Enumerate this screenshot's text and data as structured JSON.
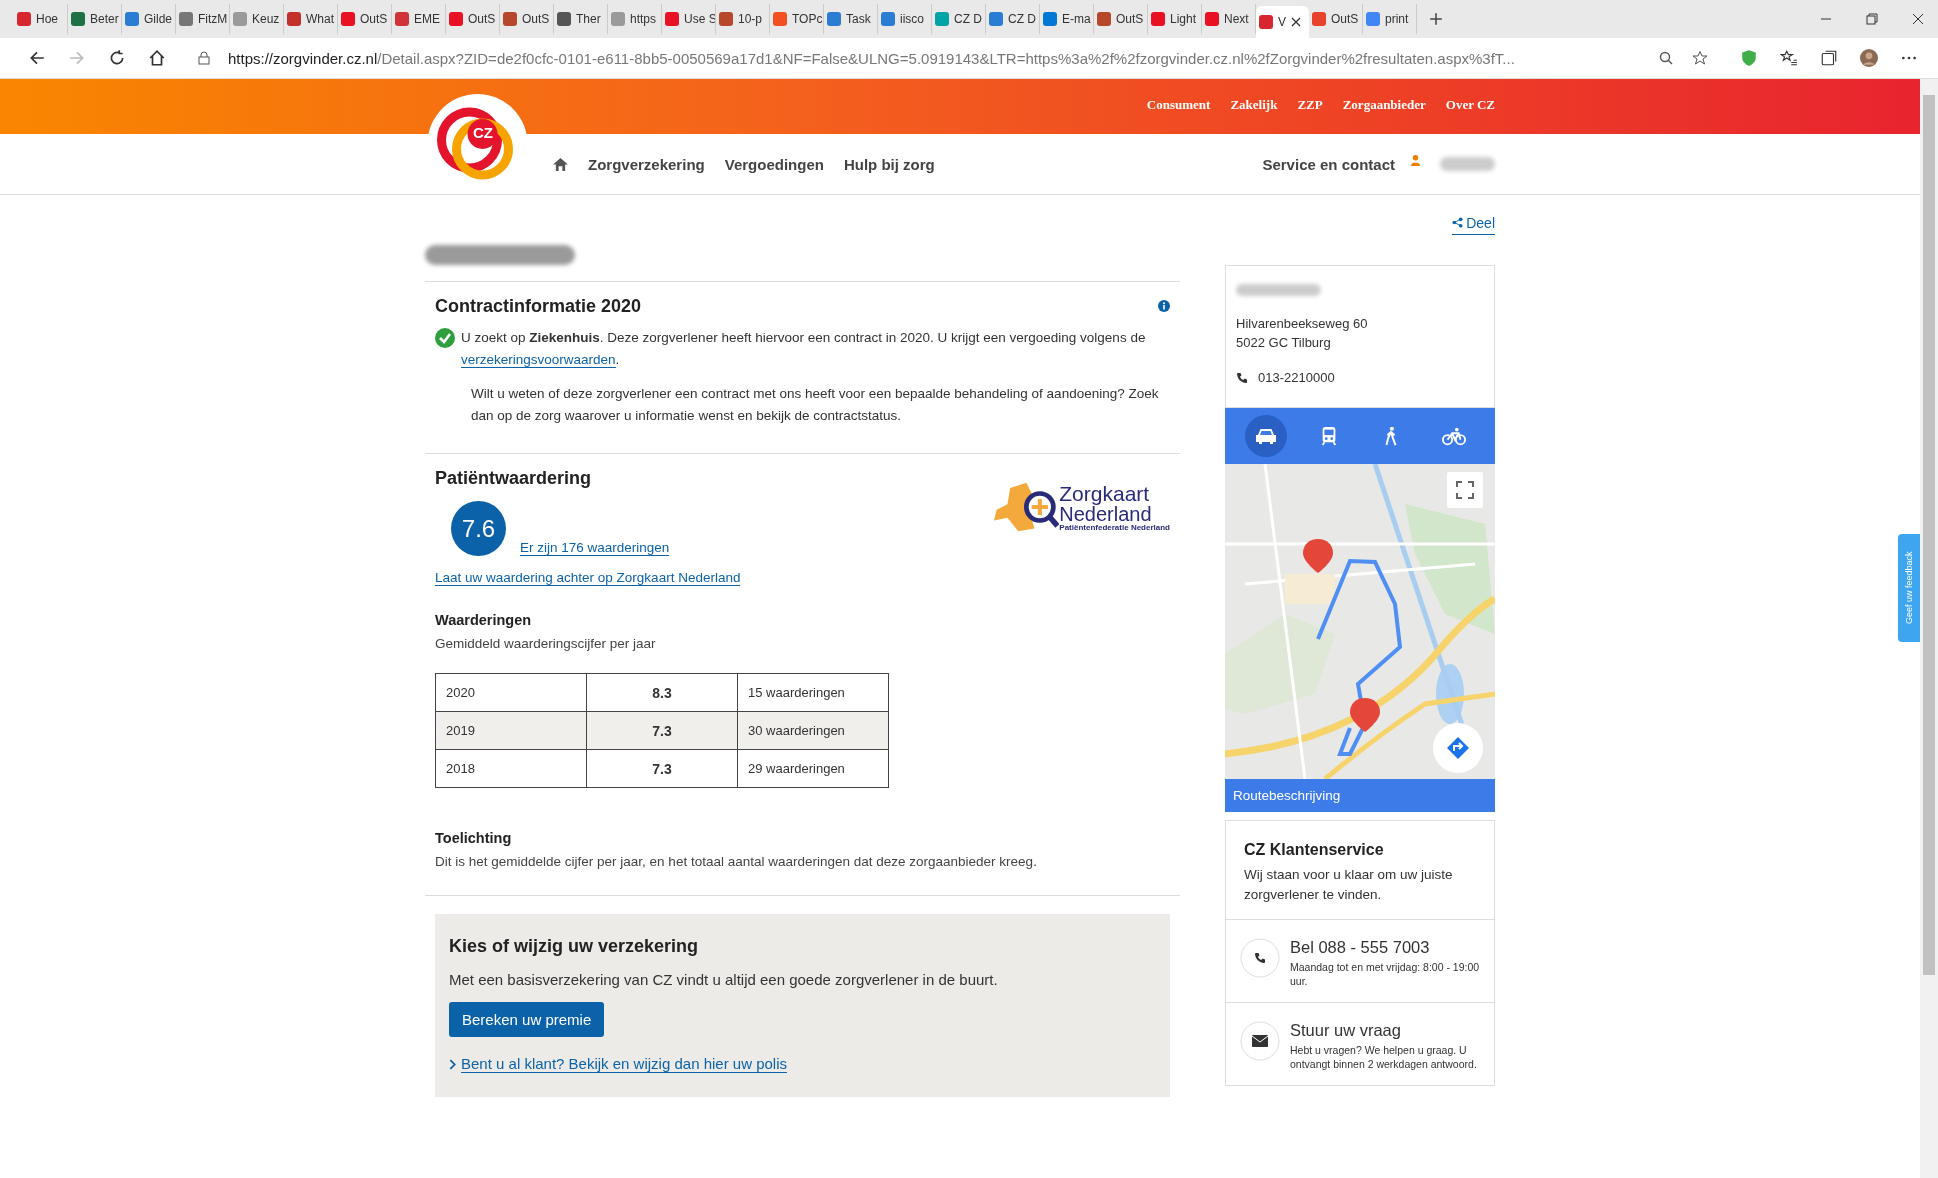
{
  "browser": {
    "tabs": [
      {
        "label": "Hoe",
        "selected": false,
        "color": "#d7262d"
      },
      {
        "label": "Beter",
        "selected": false,
        "color": "#1e7145"
      },
      {
        "label": "Gilde",
        "selected": false,
        "color": "#2b7cd3"
      },
      {
        "label": "FitzM",
        "selected": false,
        "color": "#777777"
      },
      {
        "label": "Keuz",
        "selected": false,
        "color": "#9a9a9a"
      },
      {
        "label": "What",
        "selected": false,
        "color": "#c4302b"
      },
      {
        "label": "OutS",
        "selected": false,
        "color": "#e81123"
      },
      {
        "label": "EME",
        "selected": false,
        "color": "#d13438"
      },
      {
        "label": "OutS",
        "selected": false,
        "color": "#e81123"
      },
      {
        "label": "OutS",
        "selected": false,
        "color": "#b7472a"
      },
      {
        "label": "Ther",
        "selected": false,
        "color": "#555555"
      },
      {
        "label": "https",
        "selected": false,
        "color": "#9a9a9a"
      },
      {
        "label": "Use S",
        "selected": false,
        "color": "#e81123"
      },
      {
        "label": "10-p",
        "selected": false,
        "color": "#b7472a"
      },
      {
        "label": "TOPc",
        "selected": false,
        "color": "#f25022"
      },
      {
        "label": "Task",
        "selected": false,
        "color": "#2b7cd3"
      },
      {
        "label": "iisco",
        "selected": false,
        "color": "#2b7cd3"
      },
      {
        "label": "CZ D",
        "selected": false,
        "color": "#00a4a6"
      },
      {
        "label": "CZ D",
        "selected": false,
        "color": "#2b7cd3"
      },
      {
        "label": "E-ma",
        "selected": false,
        "color": "#0078d4"
      },
      {
        "label": "OutS",
        "selected": false,
        "color": "#b7472a"
      },
      {
        "label": "Light",
        "selected": false,
        "color": "#e81123"
      },
      {
        "label": "Next",
        "selected": false,
        "color": "#e81123"
      },
      {
        "label": "V",
        "selected": true,
        "color": "#d7262d"
      },
      {
        "label": "OutS",
        "selected": false,
        "color": "#e8412c"
      },
      {
        "label": "print",
        "selected": false,
        "color": "#4285f4"
      }
    ],
    "address": {
      "domain": "https://zorgvinder.cz.nl",
      "path": "/Detail.aspx?ZID=de2f0cfc-0101-e611-8bb5-0050569a17d1&NF=False&ULNG=5.0919143&LTR=https%3a%2f%2fzorgvinder.cz.nl%2fZorgvinder%2fresultaten.aspx%3fT..."
    }
  },
  "header": {
    "logo_text": "CZ",
    "top_links": [
      "Consument",
      "Zakelijk",
      "ZZP",
      "Zorgaanbieder",
      "Over CZ"
    ],
    "nav": [
      "Zorgverzekering",
      "Vergoedingen",
      "Hulp bij zorg"
    ],
    "service": "Service en contact"
  },
  "share": "Deel",
  "contract": {
    "title": "Contractinformatie 2020",
    "text": "U zoekt op **Ziekenhuis**. Deze zorgverlener heeft hiervoor een contract in 2020. U krijgt een vergoeding volgens de",
    "link": "verzekeringsvoorwaarden",
    "after": ".",
    "note": "Wilt u weten of deze zorgverlener een contract met ons heeft voor een bepaalde behandeling of aandoening? Zoek dan op de zorg waarover u informatie wenst en bekijk de contractstatus."
  },
  "rating": {
    "title": "Patiëntwaardering",
    "score": "7.6",
    "count_link": "Er zijn 176 waarderingen",
    "leave_link": "Laat uw waardering achter op Zorgkaart Nederland",
    "logo": {
      "line1": "Zorgkaart",
      "line2": "Nederland",
      "line3": "Patiëntenfederatie Nederland"
    },
    "table_title": "Waarderingen",
    "table_subtitle": "Gemiddeld waarderingscijfer per jaar",
    "rows": [
      {
        "year": "2020",
        "score": "8.3",
        "count": "15 waarderingen"
      },
      {
        "year": "2019",
        "score": "7.3",
        "count": "30 waarderingen"
      },
      {
        "year": "2018",
        "score": "7.3",
        "count": "29 waarderingen"
      }
    ],
    "note_title": "Toelichting",
    "note": "Dit is het gemiddelde cijfer per jaar, en het totaal aantal waarderingen dat deze zorgaanbieder kreeg."
  },
  "promo": {
    "title": "Kies of wijzig uw verzekering",
    "text": "Met een basisverzekering van CZ vindt u altijd een goede zorgverlener in de buurt.",
    "button": "Bereken uw premie",
    "link": "Bent u al klant? Bekijk en wijzig dan hier uw polis"
  },
  "location": {
    "street": "Hilvarenbeekseweg 60",
    "city": "5022 GC Tilburg",
    "phone": "013-2210000",
    "modes": [
      {
        "kind": "car",
        "selected": true
      },
      {
        "kind": "transit",
        "selected": false
      },
      {
        "kind": "walk",
        "selected": false
      },
      {
        "kind": "bike",
        "selected": false
      }
    ],
    "route": "Routebeschrijving"
  },
  "service": {
    "title": "CZ Klantenservice",
    "text": "Wij staan voor u klaar om uw juiste zorgverlener te vinden.",
    "contacts": [
      {
        "kind": "phone",
        "title": "Bel 088 - 555 7003",
        "text": "Maandag tot en met vrijdag: 8:00 - 19:00 uur."
      },
      {
        "kind": "mail",
        "title": "Stuur uw vraag",
        "text": "Hebt u vragen? We helpen u graag. U ontvangt binnen 2 werkdagen antwoord."
      }
    ]
  },
  "feedback": "Geef uw feedback"
}
